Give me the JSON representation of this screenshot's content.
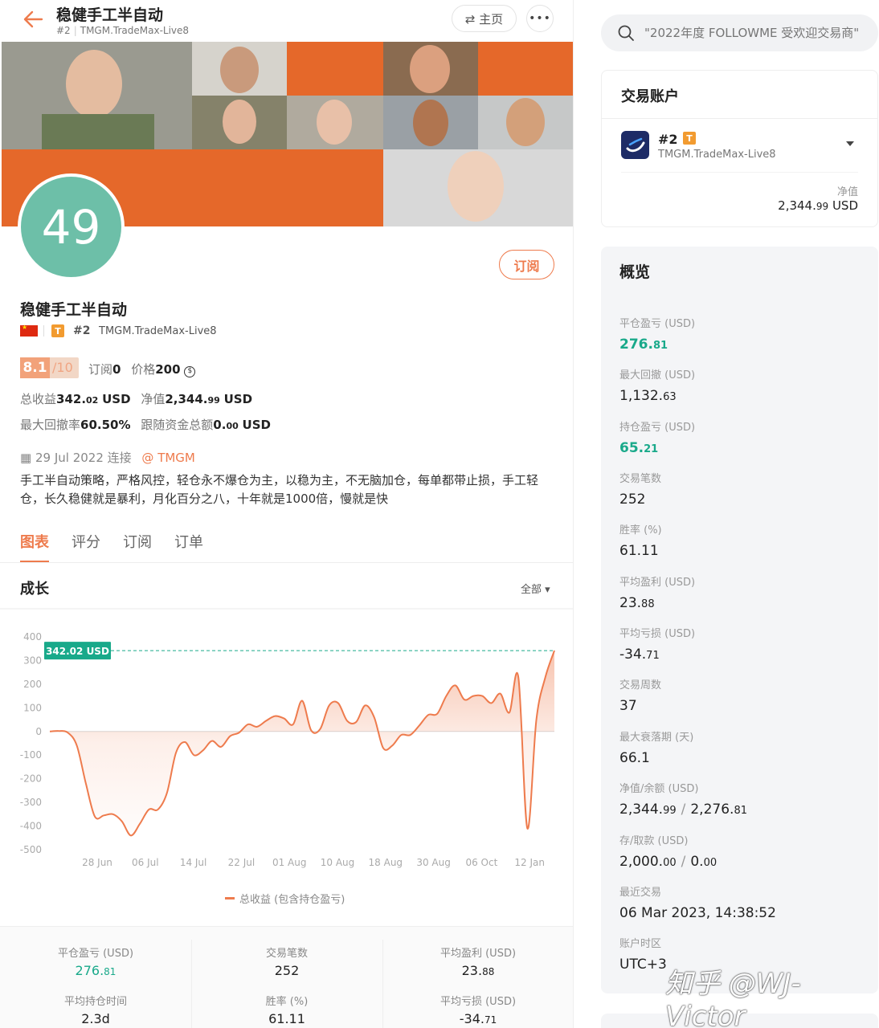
{
  "header": {
    "title": "稳健手工半自动",
    "account_num": "#2",
    "server": "TMGM.TradeMax-Live8",
    "home_label": "⇄ 主页",
    "more_label": "•••"
  },
  "profile": {
    "avatar_text": "49",
    "subscribe_label": "订阅",
    "name": "稳健手工半自动",
    "badge": "T",
    "account_num": "#2",
    "server": "TMGM.TradeMax-Live8",
    "score": "8.1",
    "score_of": "/10",
    "subscribers_label": "订阅",
    "subscribers": "0",
    "price_label": "价格",
    "price": "200",
    "total_profit_label": "总收益",
    "total_profit_int": "342.",
    "total_profit_dec": "02",
    "total_profit_unit": "USD",
    "equity_label": "净值",
    "equity_int": "2,344.",
    "equity_dec": "99",
    "equity_unit": "USD",
    "max_dd_label": "最大回撤率",
    "max_dd": "60.50%",
    "follow_funds_label": "跟随资金总额",
    "follow_funds_int": "0.",
    "follow_funds_dec": "00",
    "follow_funds_unit": "USD",
    "connected": "29 Jul 2022 连接",
    "broker_tag": "@ TMGM",
    "description": "手工半自动策略，严格风控，轻仓永不爆仓为主，以稳为主，不无脑加仓，每单都带止损，手工轻仓，长久稳健就是暴利，月化百分之八，十年就是1000倍，慢就是快"
  },
  "tabs": [
    "图表",
    "评分",
    "订阅",
    "订单"
  ],
  "growth": {
    "title": "成长",
    "range": "全部 ▾"
  },
  "chart_data": {
    "type": "area",
    "title": "",
    "ylim": [
      -500,
      400
    ],
    "yticks": [
      "400",
      "300",
      "200",
      "100",
      "0",
      "-100",
      "-200",
      "-300",
      "-400",
      "-500"
    ],
    "xticks": [
      "28 Jun",
      "06 Jul",
      "14 Jul",
      "22 Jul",
      "01 Aug",
      "10 Aug",
      "18 Aug",
      "30 Aug",
      "06 Oct",
      "12 Jan"
    ],
    "current_label": "342.02 USD",
    "current_value": 342.02,
    "series": [
      {
        "name": "总收益 (包含持仓盈亏)",
        "values": [
          0,
          2,
          -5,
          -60,
          -220,
          -360,
          -355,
          -350,
          -380,
          -440,
          -390,
          -330,
          -330,
          -260,
          -90,
          -45,
          -100,
          -80,
          -40,
          -65,
          -20,
          -5,
          30,
          20,
          45,
          65,
          55,
          30,
          130,
          5,
          10,
          110,
          120,
          45,
          40,
          110,
          60,
          -70,
          -60,
          -15,
          -15,
          25,
          70,
          75,
          150,
          195,
          135,
          150,
          150,
          120,
          160,
          80,
          230,
          -410,
          50,
          230,
          342.02
        ]
      }
    ]
  },
  "bottom_stats": [
    {
      "label": "平仓盈亏 (USD)",
      "int": "276.",
      "dec": "81",
      "green": true
    },
    {
      "label": "交易笔数",
      "int": "252",
      "dec": "",
      "green": false
    },
    {
      "label": "平均盈利 (USD)",
      "int": "23.",
      "dec": "88",
      "green": false
    },
    {
      "label": "平均持仓时间",
      "int": "2.3d",
      "dec": "",
      "green": false
    },
    {
      "label": "胜率 (%)",
      "int": "61.11",
      "dec": "",
      "green": false
    },
    {
      "label": "平均亏损 (USD)",
      "int": "-34.",
      "dec": "71",
      "green": false
    }
  ],
  "search": {
    "placeholder": "\"2022年度 FOLLOWME 受欢迎交易商\""
  },
  "account_card": {
    "title": "交易账户",
    "hash": "#2",
    "badge": "T",
    "server": "TMGM.TradeMax-Live8",
    "nv_label": "净值",
    "nv_int": "2,344.",
    "nv_dec": "99",
    "nv_unit": "USD"
  },
  "overview": {
    "title": "概览",
    "items": [
      {
        "label": "平仓盈亏 (USD)",
        "a": "276.",
        "b": "81",
        "green": true
      },
      {
        "label": "最大回撤 (USD)",
        "a": "1,132.",
        "b": "63"
      },
      {
        "label": "持仓盈亏 (USD)",
        "a": "65.",
        "b": "21",
        "green": true
      },
      {
        "label": "交易笔数",
        "a": "252",
        "b": ""
      },
      {
        "label": "胜率 (%)",
        "a": "61.11",
        "b": ""
      },
      {
        "label": "平均盈利 (USD)",
        "a": "23.",
        "b": "88"
      },
      {
        "label": "平均亏损 (USD)",
        "a": "-34.",
        "b": "71"
      },
      {
        "label": "交易周数",
        "a": "37",
        "b": ""
      },
      {
        "label": "最大衰落期 (天)",
        "a": "66.1",
        "b": ""
      },
      {
        "label": "净值/余额 (USD)",
        "a": "2,344.",
        "b": "99",
        "c": "2,276.",
        "d": "81"
      },
      {
        "label": "存/取款 (USD)",
        "a": "2,000.",
        "b": "00",
        "c": "0.",
        "d": "00"
      },
      {
        "label": "最近交易",
        "a": "06 Mar 2023, 14:38:52",
        "b": ""
      },
      {
        "label": "账户时区",
        "a": "UTC+3",
        "b": ""
      }
    ]
  },
  "watermark": "知乎 @WJ-Victor",
  "colors": {
    "accent": "#ee7b4d",
    "green": "#19a98a",
    "avatar": "#6dbfa8"
  }
}
